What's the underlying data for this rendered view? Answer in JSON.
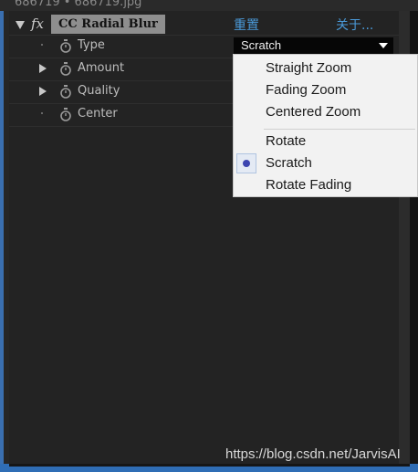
{
  "window": {
    "title": "686719 • 686719.jpg"
  },
  "effect": {
    "fx_symbol": "fx",
    "name": "CC Radial Blur",
    "reset_label": "重置",
    "about_label": "关于..."
  },
  "properties": [
    {
      "label": "Type",
      "expandable": false
    },
    {
      "label": "Amount",
      "expandable": true
    },
    {
      "label": "Quality",
      "expandable": true
    },
    {
      "label": "Center",
      "expandable": false
    }
  ],
  "type_select": {
    "value": "Scratch"
  },
  "menu": {
    "items": [
      {
        "label": "Straight Zoom",
        "selected": false
      },
      {
        "label": "Fading Zoom",
        "selected": false
      },
      {
        "label": "Centered Zoom",
        "selected": false
      },
      {
        "label": "Rotate",
        "selected": false
      },
      {
        "label": "Scratch",
        "selected": true
      },
      {
        "label": "Rotate Fading",
        "selected": false
      }
    ]
  },
  "watermark": "https://blog.csdn.net/JarvisAI",
  "colors": {
    "link": "#4a9ad9",
    "accent_border": "#3a6fb0",
    "radio": "#3c45b0"
  }
}
